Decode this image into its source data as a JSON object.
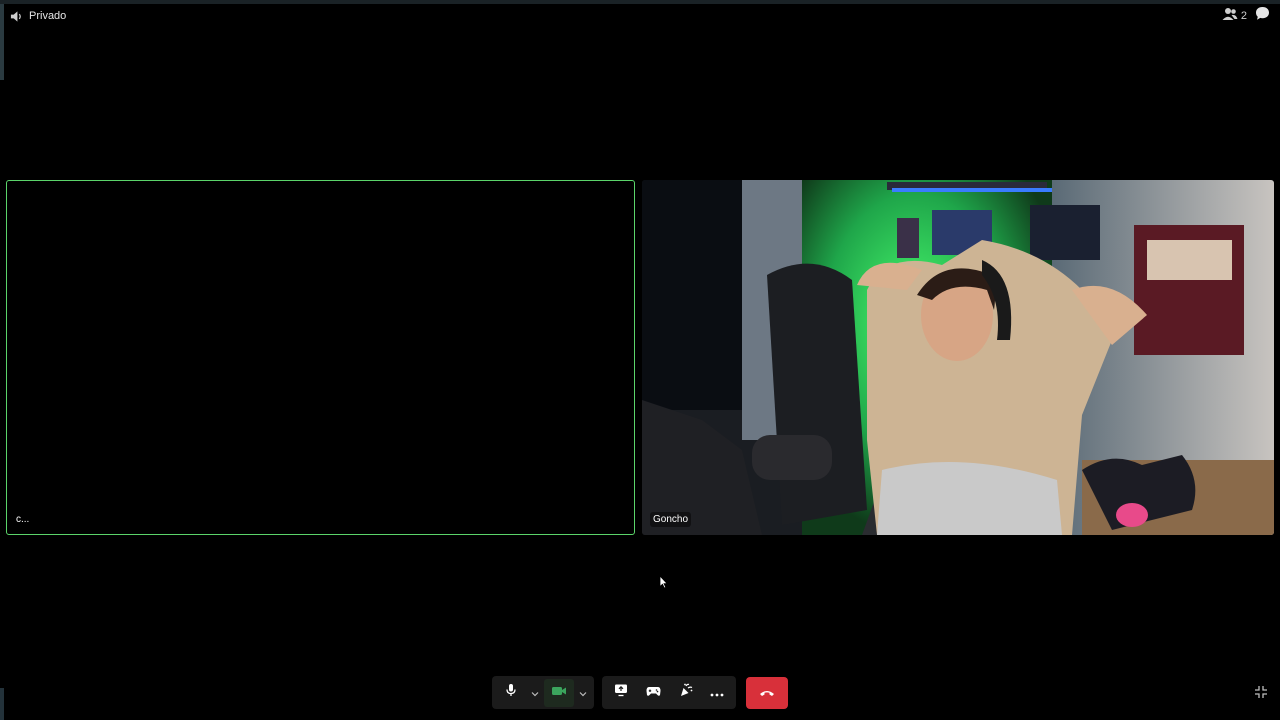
{
  "header": {
    "channel_icon": "speaker-icon",
    "title": "Privado",
    "participants_count": "2",
    "participants_icon": "people-icon",
    "chat_icon": "chat-bubble-icon"
  },
  "tiles": [
    {
      "name": "c...",
      "video": "off"
    },
    {
      "name": "Goncho",
      "video": "on"
    }
  ],
  "controls": {
    "mic_icon": "microphone-icon",
    "camera_icon": "camera-icon",
    "screenshare_icon": "screen-share-icon",
    "activity_icon": "gamepad-icon",
    "soundboard_icon": "soundboard-icon",
    "more_icon": "more-icon",
    "end_call_icon": "hang-up-icon",
    "fullscreen_icon": "exit-fullscreen-icon"
  },
  "colors": {
    "speaking_border": "#5bd46a",
    "camera_on": "#3ba55d",
    "end_call": "#d8303a"
  }
}
